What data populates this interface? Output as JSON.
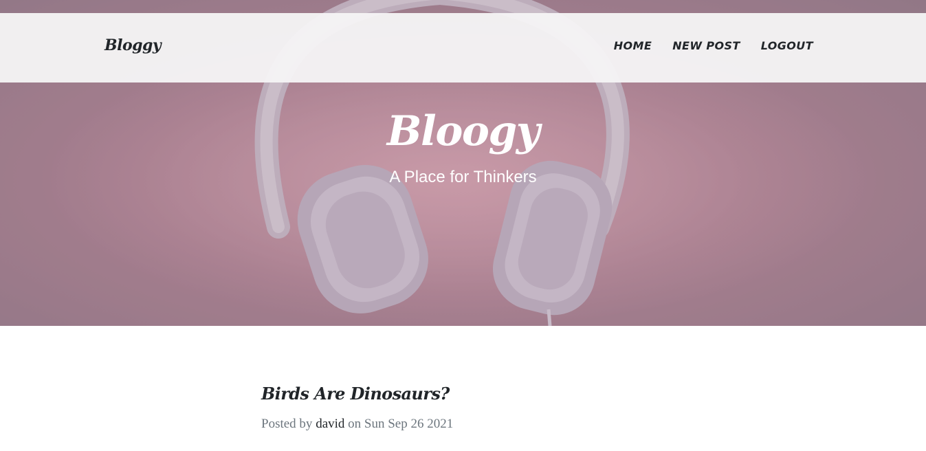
{
  "navbar": {
    "brand": "Bloggy",
    "links": [
      "HOME",
      "NEW POST",
      "LOGOUT"
    ]
  },
  "header": {
    "title": "Bloogy",
    "subtitle": "A Place for Thinkers"
  },
  "post": {
    "title": "Birds Are Dinosaurs?",
    "meta_prefix": "Posted by",
    "author": "david",
    "meta_on": "on",
    "date": "Sun Sep 26 2021"
  },
  "colors": {
    "text_dark": "#212529",
    "text_muted": "#6c757d",
    "hero_tint": "#9c7f8d"
  },
  "icons": {
    "hero_image": "headphones"
  }
}
